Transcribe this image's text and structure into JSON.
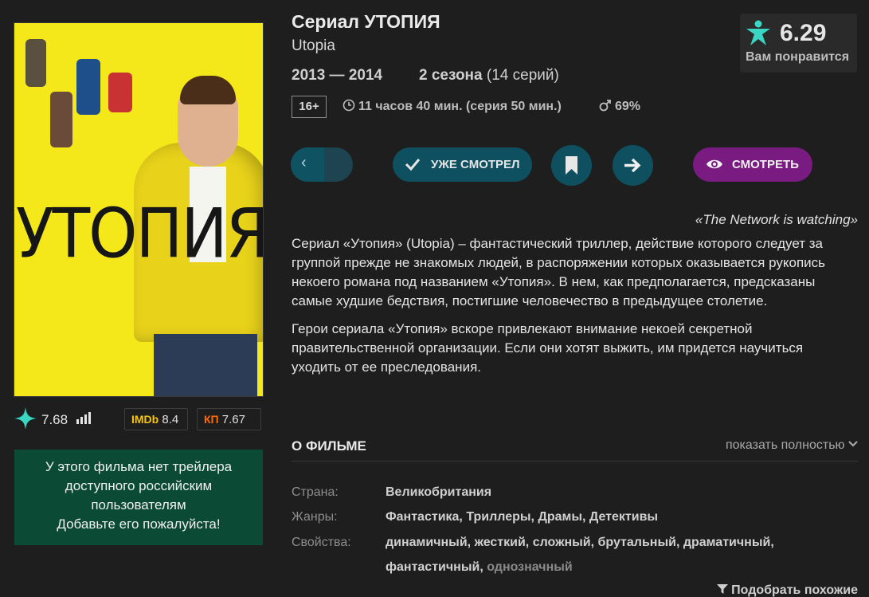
{
  "poster": {
    "title_text": "УТОПИЯ"
  },
  "ratings": {
    "kp_user_rating": "7.68",
    "imdb_label": "IMDb",
    "imdb_value": "8.4",
    "kp_label": "КП",
    "kp_value": "7.67"
  },
  "trailer_notice": {
    "line1": "У этого фильма нет трейлера",
    "line2": "доступного российским",
    "line3": "пользователям",
    "line4": "Добавьте его пожалуйста!"
  },
  "header": {
    "title": "Сериал УТОПИЯ",
    "original_title": "Utopia",
    "years": "2013 — 2014",
    "seasons": "2 сезона",
    "episodes": "(14 серий)",
    "age_rating": "16+",
    "duration": "11 часов 40 мин. (серия 50 мин.)",
    "male_audience": "69%"
  },
  "prediction": {
    "value": "6.29",
    "label": "Вам понравится"
  },
  "actions": {
    "watched_label": "УЖЕ СМОТРЕЛ",
    "watch_label": "СМОТРЕТЬ"
  },
  "tagline": "«The Network is watching»",
  "description": [
    "Сериал «Утопия» (Utopia) – фантастический триллер, действие которого следует за группой прежде не знакомых людей, в распоряжении которых оказывается рукопись некоего романа под названием «Утопия». В нем, как предполагается, предсказаны самые худшие бедствия, постигшие человечество в предыдущее столетие.",
    "Герои сериала «Утопия» вскоре привлекают внимание некоей секретной правительственной организации. Если они хотят выжить, им придется научиться уходить от ее преследования."
  ],
  "about": {
    "heading": "О ФИЛЬМЕ",
    "show_all": "показать полностью",
    "country_label": "Страна:",
    "country_value": "Великобритания",
    "genres_label": "Жанры:",
    "genres_value": "Фантастика,  Триллеры,  Драмы,  Детективы",
    "props_label": "Свойства:",
    "props_value": "динамичный,  жесткий,  сложный,  брутальный,  драматичный,  фантастичный,",
    "props_dim": "однозначный"
  },
  "similar_label": "Подобрать похожие",
  "colors": {
    "background": "#1e1e1e",
    "teal_button": "#0e5060",
    "purple_button": "#7a1b82",
    "trailer_box": "#0b4a34",
    "star_accent": "#3ad6c3"
  }
}
